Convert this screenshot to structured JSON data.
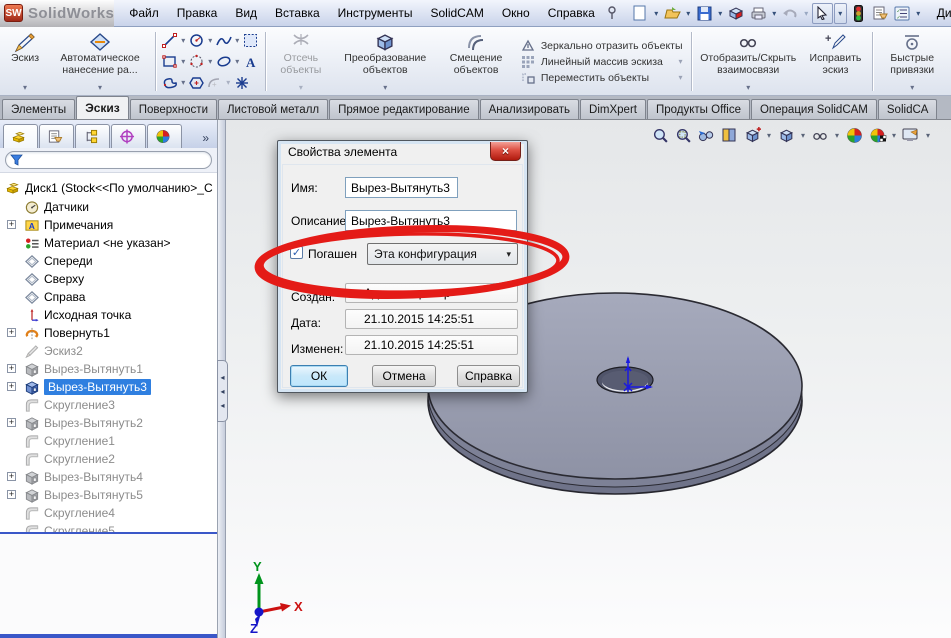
{
  "titlebar": {
    "logo_badge": "SW",
    "logo_text": "SolidWorks",
    "doc_fragment": "Ди",
    "menus": [
      "Файл",
      "Правка",
      "Вид",
      "Вставка",
      "Инструменты",
      "SolidCAM",
      "Окно",
      "Справка"
    ]
  },
  "toolbar": {
    "sketch": "Эскиз",
    "autodim": "Автоматическое нанесение ра...",
    "trim": "Отсечь объекты",
    "convert": "Преобразование объектов",
    "offset": "Смещение объектов",
    "mirror": "Зеркально отразить объекты",
    "linear_pattern": "Линейный массив эскиза",
    "move": "Переместить объекты",
    "relations": "Отобразить/Скрыть взаимосвязи",
    "repair": "Исправить эскиз",
    "snaps": "Быстрые привязки"
  },
  "ribbon_tabs": [
    "Элементы",
    "Эскиз",
    "Поверхности",
    "Листовой металл",
    "Прямое редактирование",
    "Анализировать",
    "DimXpert",
    "Продукты Office",
    "Операция SolidCAM",
    "SolidCA"
  ],
  "feature_tree": {
    "root": "Диск1  (Stock<<По умолчанию>_С",
    "items": [
      {
        "label": "Датчики"
      },
      {
        "label": "Примечания"
      },
      {
        "label": "Материал <не указан>"
      },
      {
        "label": "Спереди"
      },
      {
        "label": "Сверху"
      },
      {
        "label": "Справа"
      },
      {
        "label": "Исходная точка"
      },
      {
        "label": "Повернуть1"
      },
      {
        "label": "Эскиз2"
      },
      {
        "label": "Вырез-Вытянуть1"
      },
      {
        "label": "Вырез-Вытянуть3"
      },
      {
        "label": "Скругление3"
      },
      {
        "label": "Вырез-Вытянуть2"
      },
      {
        "label": "Скругление1"
      },
      {
        "label": "Скругление2"
      },
      {
        "label": "Вырез-Вытянуть4"
      },
      {
        "label": "Вырез-Вытянуть5"
      },
      {
        "label": "Скругление4"
      },
      {
        "label": "Скругление5"
      }
    ]
  },
  "dialog": {
    "title": "Свойства элемента",
    "name_label": "Имя:",
    "name_value": "Вырез-Вытянуть3",
    "description_label": "Описание:",
    "description_value": "Вырез-Вытянуть3",
    "suppressed_label": "Погашен",
    "suppressed_checked": true,
    "configuration_value": "Эта конфигурация",
    "created_label": "Создан:",
    "created_value": "Администратор",
    "date_label": "Дата:",
    "date_value": "21.10.2015 14:25:51",
    "modified_label": "Изменен:",
    "modified_value": "21.10.2015 14:25:51",
    "ok": "ОК",
    "cancel": "Отмена",
    "help": "Справка"
  },
  "viewport": {
    "axis_labels": {
      "x": "X",
      "y": "Y",
      "z": "Z"
    }
  },
  "glyphs": {
    "caret": "▾",
    "chevron_right": "»",
    "close": "×",
    "check": "✓",
    "plus": "+",
    "splitter_arrow": "◂"
  },
  "colors": {
    "selection_blue": "#2f7fe0",
    "annotation_red": "#e41b17",
    "disc_gray": "#9a9eb2",
    "default_button_fill": "#bee6fd"
  }
}
